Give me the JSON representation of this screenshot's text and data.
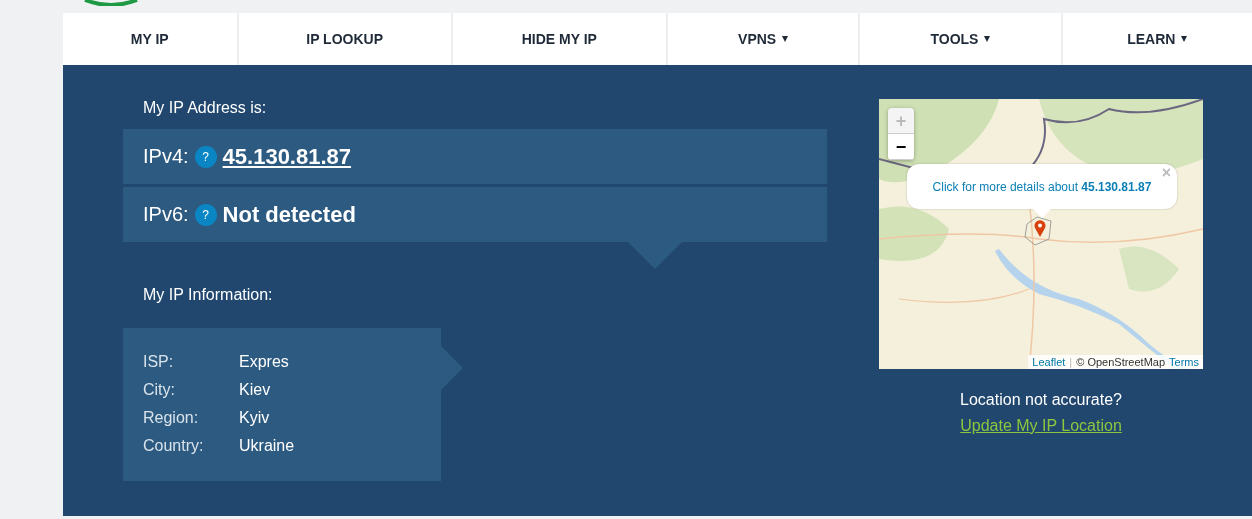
{
  "nav": [
    {
      "label": "MY IP",
      "dropdown": false
    },
    {
      "label": "IP LOOKUP",
      "dropdown": false
    },
    {
      "label": "HIDE MY IP",
      "dropdown": false
    },
    {
      "label": "VPNS",
      "dropdown": true
    },
    {
      "label": "TOOLS",
      "dropdown": true
    },
    {
      "label": "LEARN",
      "dropdown": true
    }
  ],
  "ip_address": {
    "heading": "My IP Address is:",
    "rows": [
      {
        "label": "IPv4:",
        "help": "?",
        "value": "45.130.81.87",
        "kind": "link"
      },
      {
        "label": "IPv6:",
        "help": "?",
        "value": "Not detected",
        "kind": "text"
      }
    ]
  },
  "ip_information": {
    "heading": "My IP Information:",
    "rows": [
      {
        "label": "ISP:",
        "value": "Expres"
      },
      {
        "label": "City:",
        "value": "Kiev"
      },
      {
        "label": "Region:",
        "value": "Kyiv"
      },
      {
        "label": "Country:",
        "value": "Ukraine"
      }
    ]
  },
  "map": {
    "zoom": [
      {
        "label": "+",
        "disabled": true
      },
      {
        "label": "−",
        "disabled": false
      }
    ],
    "popup": {
      "text": "Click for more details about **45.130.81.87**",
      "close": "×"
    },
    "attribution": {
      "leaflet": "Leaflet",
      "separator": "|",
      "osm": "© OpenStreetMap",
      "terms": "Terms"
    }
  },
  "location": {
    "question": "Location not accurate?",
    "link": "Update My IP Location"
  }
}
